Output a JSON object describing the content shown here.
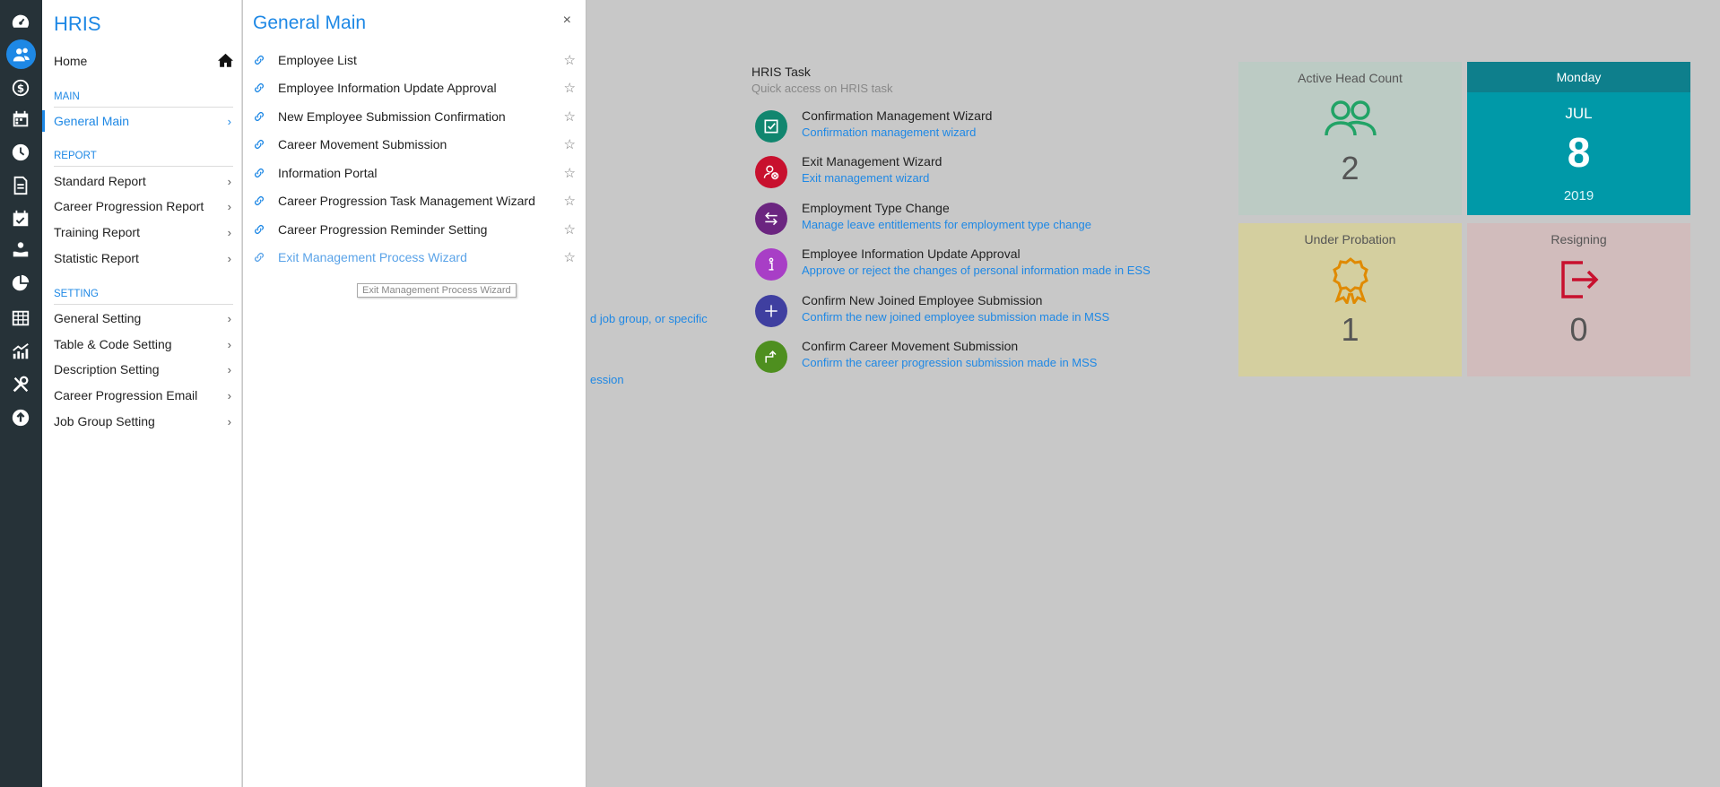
{
  "rail": {
    "icons": [
      "dashboard-icon",
      "users-icon",
      "dollar-icon",
      "calendar-icon",
      "clock-icon",
      "document-icon",
      "calendar-check-icon",
      "hand-icon",
      "pie-chart-icon",
      "grid-icon",
      "line-chart-icon",
      "tools-icon",
      "upload-icon"
    ],
    "active_index": 1
  },
  "menu": {
    "title": "HRIS",
    "home_label": "Home",
    "sections": {
      "main": {
        "label": "MAIN",
        "items": [
          {
            "label": "General Main"
          }
        ]
      },
      "report": {
        "label": "REPORT",
        "items": [
          {
            "label": "Standard Report"
          },
          {
            "label": "Career Progression Report"
          },
          {
            "label": "Training Report"
          },
          {
            "label": "Statistic Report"
          }
        ]
      },
      "setting": {
        "label": "SETTING",
        "items": [
          {
            "label": "General Setting"
          },
          {
            "label": "Table & Code Setting"
          },
          {
            "label": "Description Setting"
          },
          {
            "label": "Career Progression Email"
          },
          {
            "label": "Job Group Setting"
          }
        ]
      }
    }
  },
  "submenu": {
    "title": "General Main",
    "close_label": "×",
    "items": [
      {
        "label": "Employee List"
      },
      {
        "label": "Employee Information Update Approval"
      },
      {
        "label": "New Employee Submission Confirmation"
      },
      {
        "label": "Career Movement Submission"
      },
      {
        "label": "Information Portal"
      },
      {
        "label": "Career Progression Task Management Wizard"
      },
      {
        "label": "Career Progression Reminder Setting"
      },
      {
        "label": "Exit Management Process Wizard"
      }
    ],
    "tooltip": "Exit Management Process Wizard"
  },
  "background": {
    "fragment_1": "d job group, or specific",
    "fragment_2": "ession"
  },
  "tasks": {
    "title": "HRIS Task",
    "subtitle": "Quick access on HRIS task",
    "items": [
      {
        "name": "Confirmation Management Wizard",
        "desc": "Confirmation management wizard",
        "color": "#11866f",
        "icon": "checkbox-icon"
      },
      {
        "name": "Exit Management Wizard",
        "desc": "Exit management wizard",
        "color": "#c8102e",
        "icon": "user-remove-icon"
      },
      {
        "name": "Employment Type Change",
        "desc": "Manage leave entitlements for employment type change",
        "color": "#6b2580",
        "icon": "swap-arrows-icon"
      },
      {
        "name": "Employee Information Update Approval",
        "desc": "Approve or reject the changes of personal information made in ESS",
        "color": "#a83ec6",
        "icon": "info-icon"
      },
      {
        "name": "Confirm New Joined Employee Submission",
        "desc": "Confirm the new joined employee submission made in MSS",
        "color": "#3f3fa0",
        "icon": "plus-icon"
      },
      {
        "name": "Confirm Career Movement Submission",
        "desc": "Confirm the career progression submission made in MSS",
        "color": "#4e8f1f",
        "icon": "step-up-icon"
      }
    ]
  },
  "tiles": {
    "active_head_count": {
      "label": "Active Head Count",
      "value": "2",
      "bg": "#bccbc4",
      "icon_color": "#21a366"
    },
    "date": {
      "weekday": "Monday",
      "month": "JUL",
      "day": "8",
      "year": "2019",
      "bg": "#0099a8",
      "head_bg": "#0e7f8c"
    },
    "under_probation": {
      "label": "Under Probation",
      "value": "1",
      "bg": "#d4cf9f",
      "icon_color": "#e08a00"
    },
    "resigning": {
      "label": "Resigning",
      "value": "0",
      "bg": "#d1bcbc",
      "icon_color": "#c8102e"
    }
  }
}
